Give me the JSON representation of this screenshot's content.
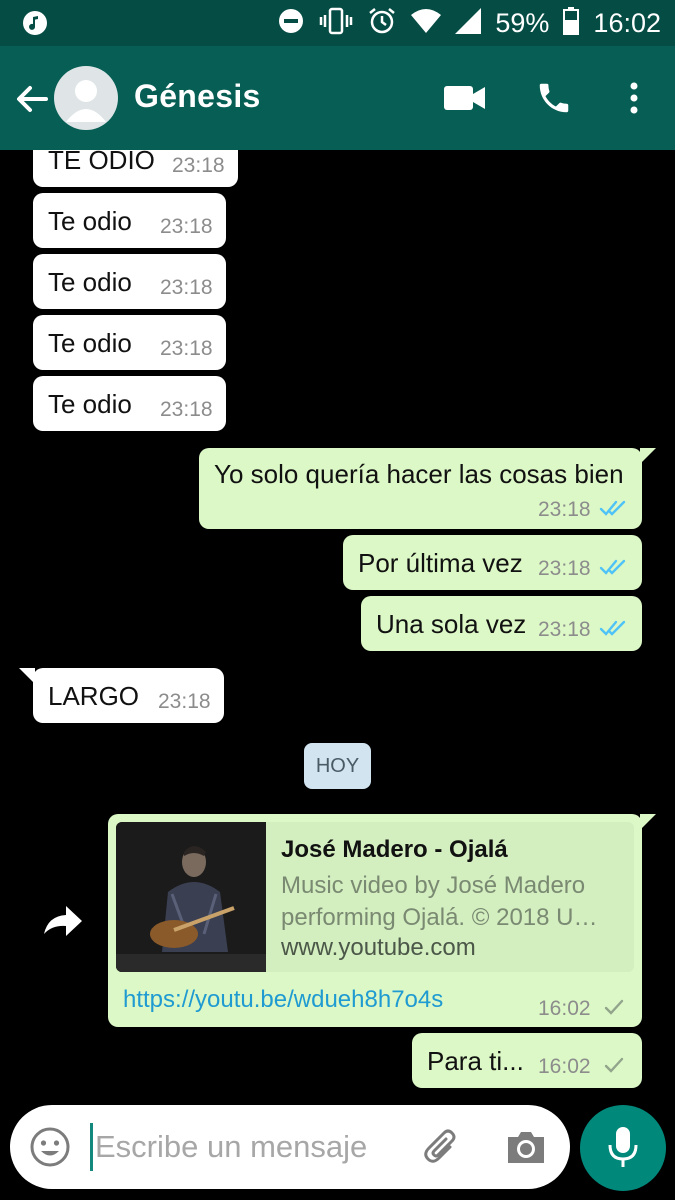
{
  "status_bar": {
    "battery": "59%",
    "time": "16:02",
    "icons": [
      "music-note-icon",
      "dnd-icon",
      "vibrate-icon",
      "alarm-icon",
      "wifi-icon",
      "signal-icon",
      "battery-icon"
    ]
  },
  "header": {
    "contact_name": "Génesis",
    "icons": [
      "back-arrow-icon",
      "avatar-icon",
      "video-call-icon",
      "phone-call-icon",
      "more-vert-icon"
    ]
  },
  "messages": [
    {
      "dir": "in",
      "text": "TE ODIO",
      "time": "23:18"
    },
    {
      "dir": "in",
      "text": "Te odio",
      "time": "23:18"
    },
    {
      "dir": "in",
      "text": "Te odio",
      "time": "23:18"
    },
    {
      "dir": "in",
      "text": "Te odio",
      "time": "23:18"
    },
    {
      "dir": "in",
      "text": "Te odio",
      "time": "23:18"
    },
    {
      "dir": "out",
      "text": "Yo solo quería hacer las cosas bien",
      "time": "23:18",
      "status": "read"
    },
    {
      "dir": "out",
      "text": "Por última vez",
      "time": "23:18",
      "status": "read"
    },
    {
      "dir": "out",
      "text": "Una sola vez",
      "time": "23:18",
      "status": "read"
    },
    {
      "dir": "in",
      "text": "LARGO",
      "time": "23:18"
    },
    {
      "dir": "out",
      "text": "https://youtu.be/wdueh8h7o4s",
      "time": "16:02",
      "status": "delivered"
    },
    {
      "dir": "out",
      "text": "Para ti...",
      "time": "16:02",
      "status": "delivered"
    }
  ],
  "date_divider": "HOY",
  "link_preview": {
    "title": "José Madero - Ojalá",
    "desc_line1": "Music video by José Madero",
    "desc_line2": "performing Ojalá. © 2018 U…",
    "site": "www.youtube.com"
  },
  "composer": {
    "placeholder": "Escribe un mensaje",
    "icons": [
      "emoji-icon",
      "paperclip-icon",
      "camera-icon",
      "mic-icon"
    ]
  },
  "colors": {
    "status_bar": "#054c44",
    "app_bar": "#075e54",
    "outgoing_bubble": "#dcf8c6",
    "incoming_bubble": "#ffffff",
    "read_ticks": "#4fc3f7",
    "mic_button": "#00897b"
  }
}
